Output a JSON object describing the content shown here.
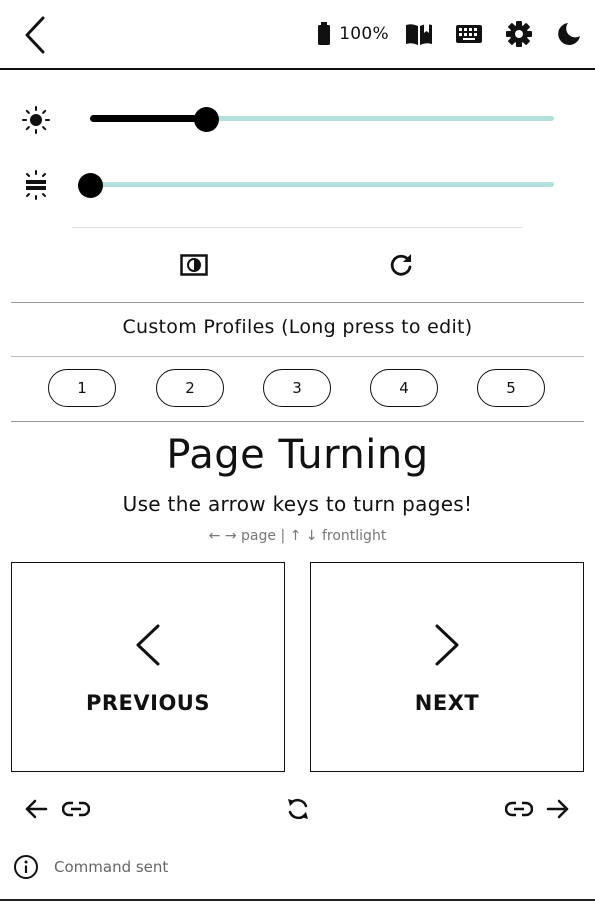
{
  "topbar": {
    "battery_percent": "100%",
    "icons": [
      "back-chevron-icon",
      "battery-icon",
      "book-icon",
      "keyboard-icon",
      "gear-icon",
      "moon-icon"
    ]
  },
  "sliders": {
    "brightness": {
      "icon": "sun-icon",
      "value_fraction": 0.25
    },
    "warmth": {
      "icon": "warmth-icon",
      "value_fraction": 0.0
    }
  },
  "actions": {
    "icons": [
      "contrast-icon",
      "refresh-icon"
    ]
  },
  "profiles": {
    "label": "Custom Profiles (Long press to edit)",
    "buttons": [
      "1",
      "2",
      "3",
      "4",
      "5"
    ]
  },
  "page_turning": {
    "title": "Page Turning",
    "subtitle": "Use the arrow keys to turn pages!",
    "hint": "← → page | ↑ ↓ frontlight",
    "previous_label": "PREVIOUS",
    "next_label": "NEXT"
  },
  "bottom_nav": {
    "icons": [
      "arrow-left-icon",
      "link-icon",
      "sync-icon",
      "link-icon",
      "arrow-right-icon"
    ]
  },
  "status": {
    "text": "Command sent",
    "icon": "info-icon"
  },
  "colors": {
    "accent_track": "#b3e0dd",
    "ink": "#111111",
    "muted": "#777777"
  }
}
